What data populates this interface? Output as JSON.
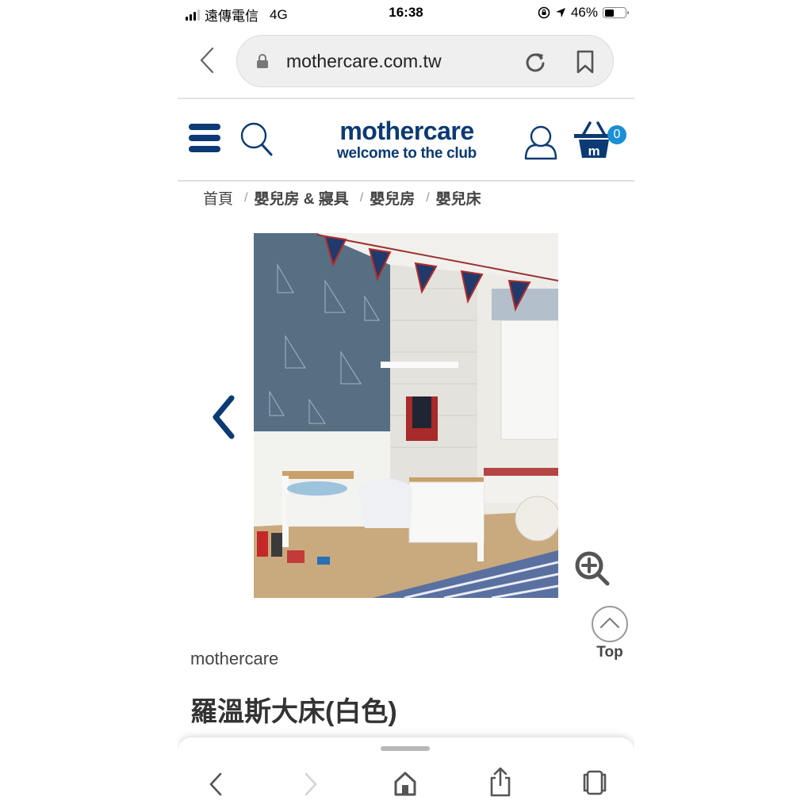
{
  "status_bar": {
    "carrier": "遠傳電信",
    "network": "4G",
    "time": "16:38",
    "battery_percent": "46%",
    "battery_level": 0.46,
    "icons": [
      "signal-icon",
      "orientation-lock-icon",
      "location-arrow-icon",
      "battery-icon"
    ]
  },
  "browser": {
    "url": "mothercare.com.tw",
    "icons": [
      "back-chevron-icon",
      "lock-icon",
      "reload-icon",
      "bookmark-icon"
    ]
  },
  "site_header": {
    "brand": "mothercare",
    "tagline": "welcome to the club",
    "cart_count": "0",
    "brand_color": "#0b3a75",
    "badge_color": "#1a8fd6",
    "icons": [
      "hamburger-menu-icon",
      "search-icon",
      "account-icon",
      "basket-icon"
    ]
  },
  "breadcrumb": [
    {
      "label": "首頁"
    },
    {
      "label": "嬰兒房 & 寢具"
    },
    {
      "label": "嬰兒房"
    },
    {
      "label": "嬰兒床"
    }
  ],
  "product": {
    "image_alt": "白色兒童床擺放在海洋風格兒童房",
    "brand": "mothercare",
    "title": "羅溫斯大床(白色)"
  },
  "controls": {
    "top_label": "Top"
  },
  "toolbar": {
    "icons": [
      "back-icon",
      "forward-icon",
      "home-icon",
      "share-icon",
      "tabs-icon"
    ]
  }
}
